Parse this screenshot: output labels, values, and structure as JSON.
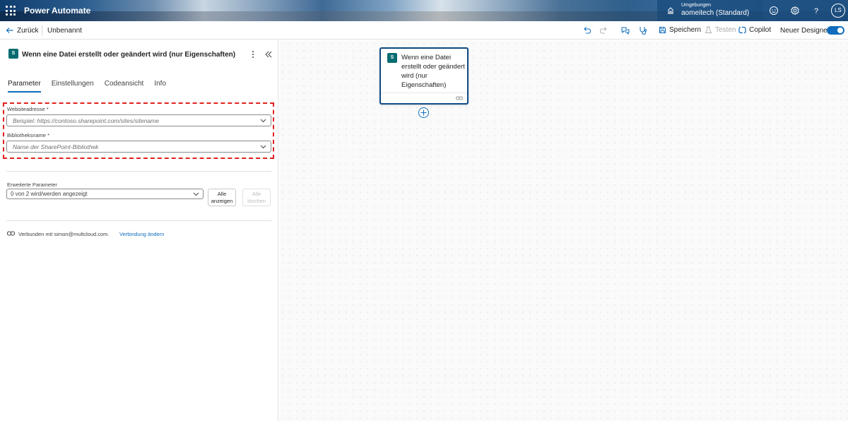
{
  "header": {
    "app_name": "Power Automate",
    "environment_label": "Umgebungen",
    "environment_name": "aomeitech (Standard)",
    "avatar_initials": "LS"
  },
  "toolbar": {
    "back_label": "Zurück",
    "flow_title": "Unbenannt",
    "save_label": "Speichern",
    "test_label": "Testen",
    "copilot_label": "Copilot",
    "new_designer_label": "Neuer Designer",
    "new_designer_enabled": true
  },
  "panel": {
    "title": "Wenn eine Datei erstellt oder geändert wird (nur Eigenschaften)",
    "icon_text": "S",
    "tabs": [
      "Parameter",
      "Einstellungen",
      "Codeansicht",
      "Info"
    ],
    "active_tab": "Parameter",
    "site_label": "Websiteadresse *",
    "site_placeholder": "Beispiel: https://contoso.sharepoint.com/sites/sitename",
    "library_label": "Bibliotheksname *",
    "library_placeholder": "Name der SharePoint-Bibliothek",
    "advanced_label": "Erweiterte Parameter",
    "advanced_value": "0 von 2 wird/werden angezeigt",
    "show_all_line1": "Alle",
    "show_all_line2": "anzeigen",
    "clear_all_line1": "Alle",
    "clear_all_line2": "löschen",
    "connection_text": "Verbunden mit simon@multcloud.com.",
    "change_connection": "Verbindung ändern"
  },
  "canvas": {
    "node_title": "Wenn eine Datei erstellt oder geändert wird (nur Eigenschaften)",
    "node_icon_text": "S"
  },
  "colors": {
    "accent": "#0f6cbd",
    "sharepoint": "#036c70",
    "highlight": "#e02020"
  }
}
